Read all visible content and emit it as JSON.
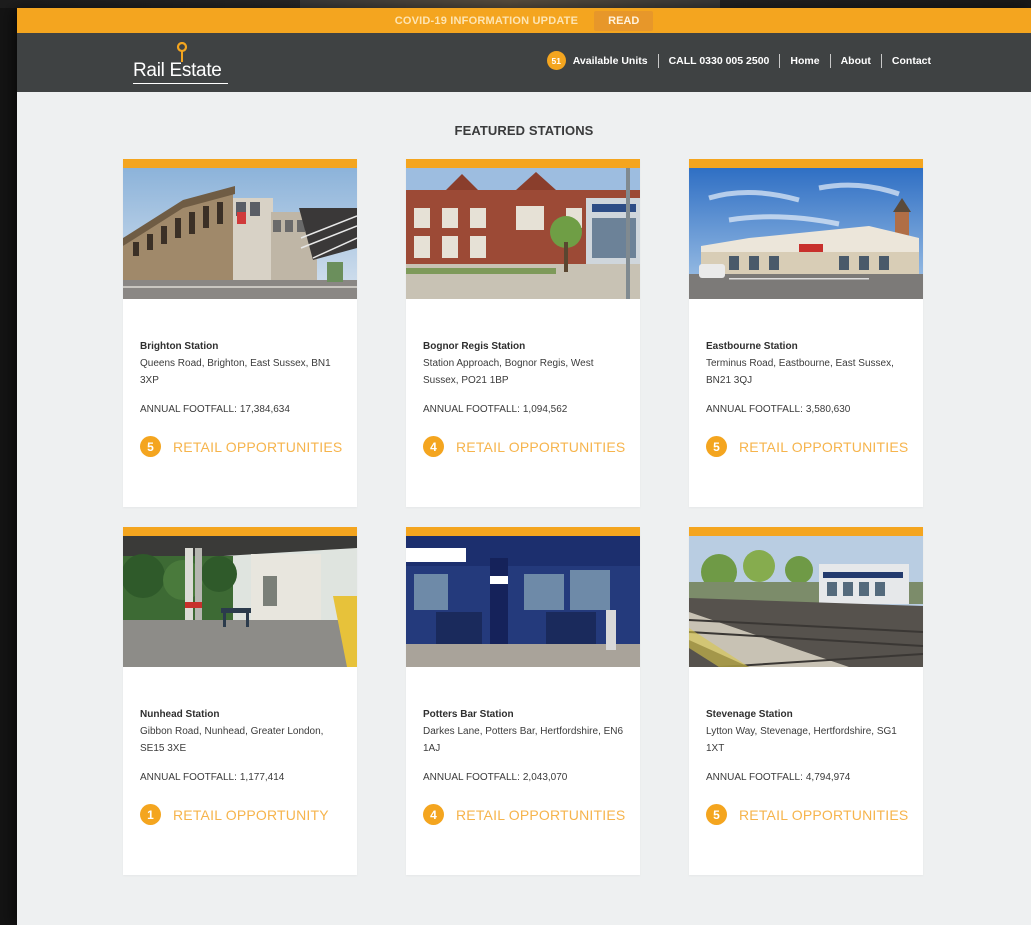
{
  "banner": {
    "text": "COVID-19 INFORMATION UPDATE",
    "read_label": "READ"
  },
  "header": {
    "logo_text": "Rail Estate",
    "available_units_count": "51",
    "available_units_label": "Available Units",
    "phone_label": "CALL 0330 005 2500",
    "nav": [
      "Home",
      "About",
      "Contact"
    ]
  },
  "colors": {
    "accent": "#f4a51f",
    "header_bg": "#3f4243",
    "page_bg": "#eef0f1"
  },
  "main": {
    "title": "FEATURED STATIONS"
  },
  "footfall_label": "ANNUAL FOOTFALL:",
  "stations": [
    {
      "name": "Brighton Station",
      "address": "Queens Road, Brighton, East Sussex, BN1 3XP",
      "footfall": "17,384,634",
      "retail_count": "5",
      "retail_label": "RETAIL OPPORTUNITIES"
    },
    {
      "name": "Bognor Regis Station",
      "address": "Station Approach, Bognor Regis, West Sussex, PO21 1BP",
      "footfall": "1,094,562",
      "retail_count": "4",
      "retail_label": "RETAIL OPPORTUNITIES"
    },
    {
      "name": "Eastbourne Station",
      "address": "Terminus Road, Eastbourne, East Sussex, BN21 3QJ",
      "footfall": "3,580,630",
      "retail_count": "5",
      "retail_label": "RETAIL OPPORTUNITIES"
    },
    {
      "name": "Nunhead Station",
      "address": "Gibbon Road, Nunhead, Greater London, SE15 3XE",
      "footfall": "1,177,414",
      "retail_count": "1",
      "retail_label": "RETAIL OPPORTUNITY"
    },
    {
      "name": "Potters Bar Station",
      "address": "Darkes Lane, Potters Bar, Hertfordshire, EN6 1AJ",
      "footfall": "2,043,070",
      "retail_count": "4",
      "retail_label": "RETAIL OPPORTUNITIES"
    },
    {
      "name": "Stevenage Station",
      "address": "Lytton Way, Stevenage, Hertfordshire, SG1 1XT",
      "footfall": "4,794,974",
      "retail_count": "5",
      "retail_label": "RETAIL OPPORTUNITIES"
    }
  ]
}
